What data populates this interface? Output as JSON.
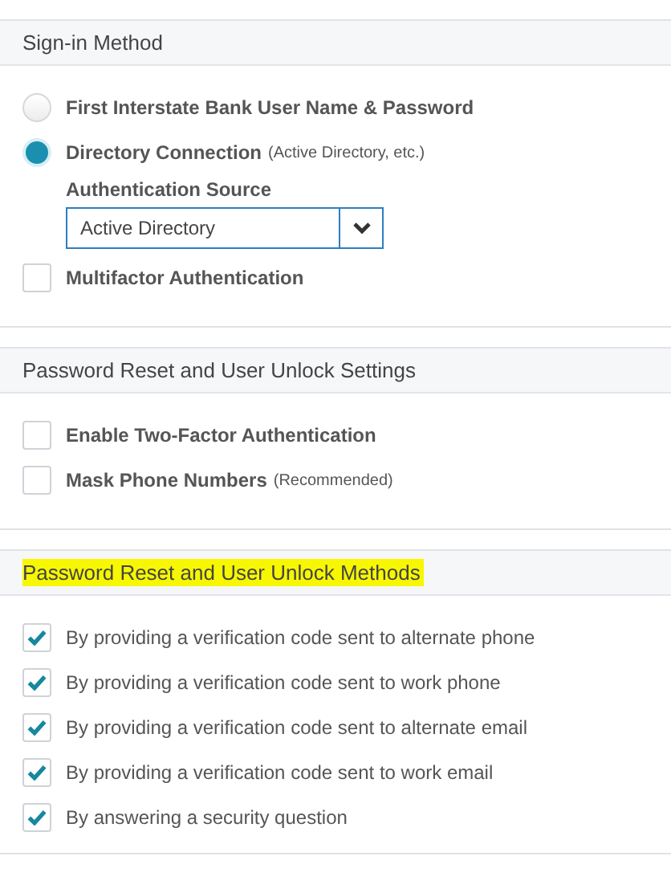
{
  "sections": [
    {
      "title": "Sign-in Method",
      "highlighted": false,
      "kind": "options",
      "items": [
        {
          "kind": "radio",
          "label": "First Interstate Bank User Name & Password",
          "selected": false
        },
        {
          "kind": "radio",
          "label": "Directory Connection",
          "note": "(Active Directory, etc.)",
          "selected": true
        },
        {
          "kind": "select",
          "label": "Authentication Source",
          "value": "Active Directory"
        },
        {
          "kind": "checkbox",
          "label": "Multifactor Authentication",
          "checked": false
        }
      ]
    },
    {
      "title": "Password Reset and User Unlock Settings",
      "highlighted": false,
      "kind": "options",
      "items": [
        {
          "kind": "checkbox",
          "label": "Enable Two-Factor Authentication",
          "checked": false
        },
        {
          "kind": "checkbox",
          "label": "Mask Phone Numbers",
          "note": "(Recommended)",
          "checked": false
        }
      ]
    },
    {
      "title": "Password Reset and User Unlock Methods",
      "highlighted": true,
      "kind": "methods",
      "items": [
        {
          "kind": "checkbox",
          "label": "By providing a verification code sent to alternate phone",
          "checked": true
        },
        {
          "kind": "checkbox",
          "label": "By providing a verification code sent to work phone",
          "checked": true
        },
        {
          "kind": "checkbox",
          "label": "By providing a verification code sent to alternate email",
          "checked": true
        },
        {
          "kind": "checkbox",
          "label": "By providing a verification code sent to work email",
          "checked": true
        },
        {
          "kind": "checkbox",
          "label": "By answering a security question",
          "checked": true
        }
      ]
    }
  ]
}
